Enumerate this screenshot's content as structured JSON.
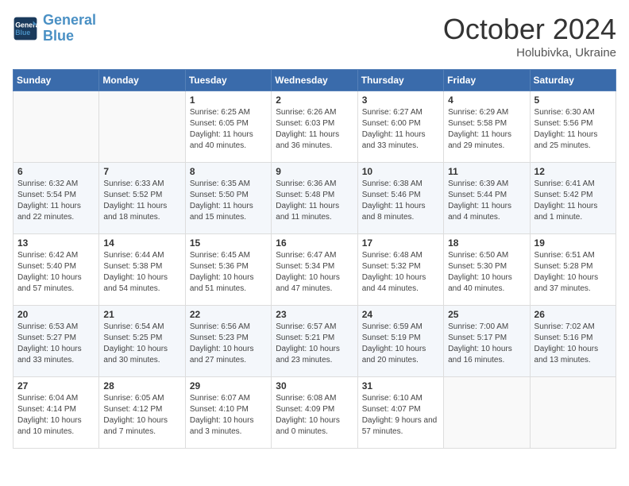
{
  "header": {
    "logo_line1": "General",
    "logo_line2": "Blue",
    "month": "October 2024",
    "location": "Holubivka, Ukraine"
  },
  "days_of_week": [
    "Sunday",
    "Monday",
    "Tuesday",
    "Wednesday",
    "Thursday",
    "Friday",
    "Saturday"
  ],
  "weeks": [
    [
      {
        "day": "",
        "info": ""
      },
      {
        "day": "",
        "info": ""
      },
      {
        "day": "1",
        "info": "Sunrise: 6:25 AM\nSunset: 6:05 PM\nDaylight: 11 hours and 40 minutes."
      },
      {
        "day": "2",
        "info": "Sunrise: 6:26 AM\nSunset: 6:03 PM\nDaylight: 11 hours and 36 minutes."
      },
      {
        "day": "3",
        "info": "Sunrise: 6:27 AM\nSunset: 6:00 PM\nDaylight: 11 hours and 33 minutes."
      },
      {
        "day": "4",
        "info": "Sunrise: 6:29 AM\nSunset: 5:58 PM\nDaylight: 11 hours and 29 minutes."
      },
      {
        "day": "5",
        "info": "Sunrise: 6:30 AM\nSunset: 5:56 PM\nDaylight: 11 hours and 25 minutes."
      }
    ],
    [
      {
        "day": "6",
        "info": "Sunrise: 6:32 AM\nSunset: 5:54 PM\nDaylight: 11 hours and 22 minutes."
      },
      {
        "day": "7",
        "info": "Sunrise: 6:33 AM\nSunset: 5:52 PM\nDaylight: 11 hours and 18 minutes."
      },
      {
        "day": "8",
        "info": "Sunrise: 6:35 AM\nSunset: 5:50 PM\nDaylight: 11 hours and 15 minutes."
      },
      {
        "day": "9",
        "info": "Sunrise: 6:36 AM\nSunset: 5:48 PM\nDaylight: 11 hours and 11 minutes."
      },
      {
        "day": "10",
        "info": "Sunrise: 6:38 AM\nSunset: 5:46 PM\nDaylight: 11 hours and 8 minutes."
      },
      {
        "day": "11",
        "info": "Sunrise: 6:39 AM\nSunset: 5:44 PM\nDaylight: 11 hours and 4 minutes."
      },
      {
        "day": "12",
        "info": "Sunrise: 6:41 AM\nSunset: 5:42 PM\nDaylight: 11 hours and 1 minute."
      }
    ],
    [
      {
        "day": "13",
        "info": "Sunrise: 6:42 AM\nSunset: 5:40 PM\nDaylight: 10 hours and 57 minutes."
      },
      {
        "day": "14",
        "info": "Sunrise: 6:44 AM\nSunset: 5:38 PM\nDaylight: 10 hours and 54 minutes."
      },
      {
        "day": "15",
        "info": "Sunrise: 6:45 AM\nSunset: 5:36 PM\nDaylight: 10 hours and 51 minutes."
      },
      {
        "day": "16",
        "info": "Sunrise: 6:47 AM\nSunset: 5:34 PM\nDaylight: 10 hours and 47 minutes."
      },
      {
        "day": "17",
        "info": "Sunrise: 6:48 AM\nSunset: 5:32 PM\nDaylight: 10 hours and 44 minutes."
      },
      {
        "day": "18",
        "info": "Sunrise: 6:50 AM\nSunset: 5:30 PM\nDaylight: 10 hours and 40 minutes."
      },
      {
        "day": "19",
        "info": "Sunrise: 6:51 AM\nSunset: 5:28 PM\nDaylight: 10 hours and 37 minutes."
      }
    ],
    [
      {
        "day": "20",
        "info": "Sunrise: 6:53 AM\nSunset: 5:27 PM\nDaylight: 10 hours and 33 minutes."
      },
      {
        "day": "21",
        "info": "Sunrise: 6:54 AM\nSunset: 5:25 PM\nDaylight: 10 hours and 30 minutes."
      },
      {
        "day": "22",
        "info": "Sunrise: 6:56 AM\nSunset: 5:23 PM\nDaylight: 10 hours and 27 minutes."
      },
      {
        "day": "23",
        "info": "Sunrise: 6:57 AM\nSunset: 5:21 PM\nDaylight: 10 hours and 23 minutes."
      },
      {
        "day": "24",
        "info": "Sunrise: 6:59 AM\nSunset: 5:19 PM\nDaylight: 10 hours and 20 minutes."
      },
      {
        "day": "25",
        "info": "Sunrise: 7:00 AM\nSunset: 5:17 PM\nDaylight: 10 hours and 16 minutes."
      },
      {
        "day": "26",
        "info": "Sunrise: 7:02 AM\nSunset: 5:16 PM\nDaylight: 10 hours and 13 minutes."
      }
    ],
    [
      {
        "day": "27",
        "info": "Sunrise: 6:04 AM\nSunset: 4:14 PM\nDaylight: 10 hours and 10 minutes."
      },
      {
        "day": "28",
        "info": "Sunrise: 6:05 AM\nSunset: 4:12 PM\nDaylight: 10 hours and 7 minutes."
      },
      {
        "day": "29",
        "info": "Sunrise: 6:07 AM\nSunset: 4:10 PM\nDaylight: 10 hours and 3 minutes."
      },
      {
        "day": "30",
        "info": "Sunrise: 6:08 AM\nSunset: 4:09 PM\nDaylight: 10 hours and 0 minutes."
      },
      {
        "day": "31",
        "info": "Sunrise: 6:10 AM\nSunset: 4:07 PM\nDaylight: 9 hours and 57 minutes."
      },
      {
        "day": "",
        "info": ""
      },
      {
        "day": "",
        "info": ""
      }
    ]
  ]
}
